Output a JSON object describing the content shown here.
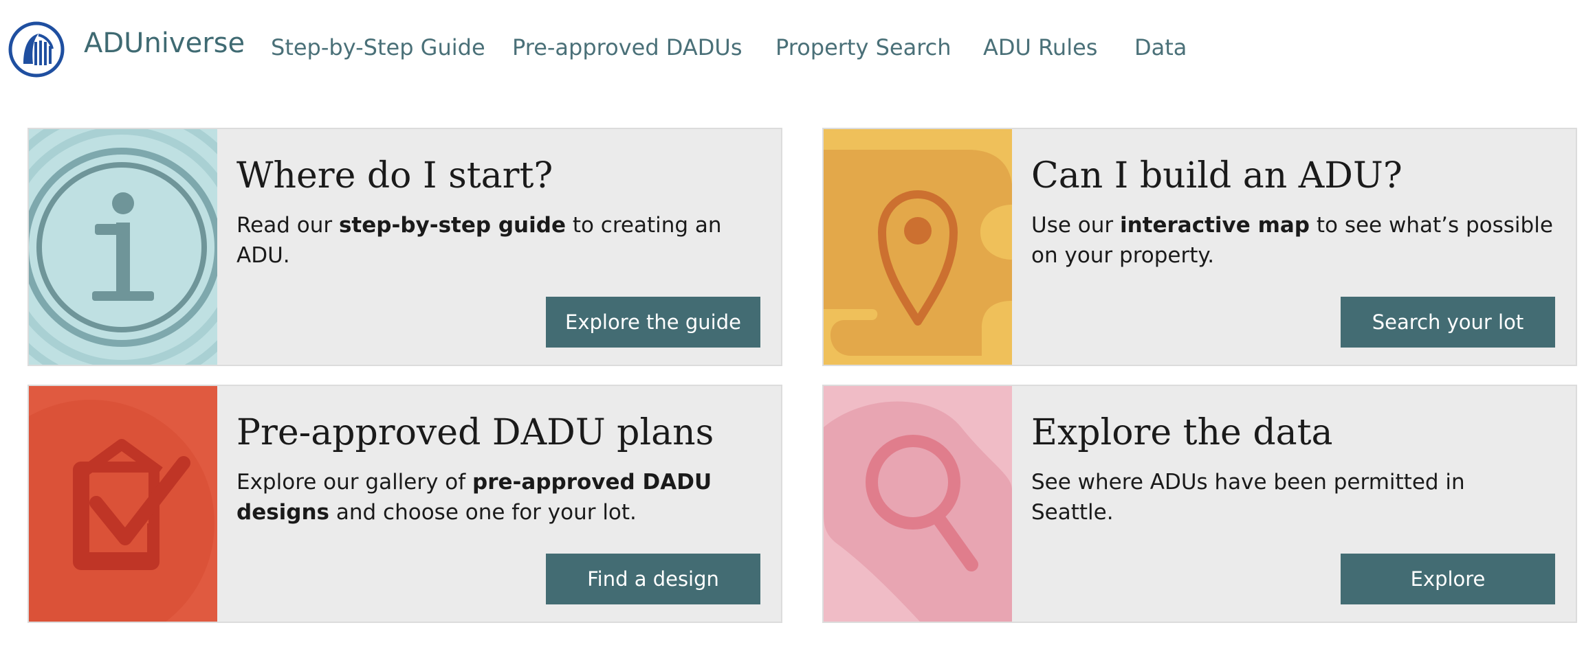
{
  "header": {
    "brand": "ADUniverse",
    "nav": [
      {
        "label": "Step-by-Step Guide"
      },
      {
        "label": "Pre-approved DADUs"
      },
      {
        "label": "Property Search"
      },
      {
        "label": "ADU Rules"
      },
      {
        "label": "Data"
      }
    ]
  },
  "cards": [
    {
      "title": "Where do I start?",
      "text_before": "Read our ",
      "text_bold": "step-by-step guide",
      "text_after": " to creating an ADU.",
      "button": "Explore the guide",
      "icon": "info-icon",
      "color": "#bfe0e2"
    },
    {
      "title": "Can I build an ADU?",
      "text_before": "Use our ",
      "text_bold": "interactive map",
      "text_after": " to see what’s possible on your property.",
      "button": "Search your lot",
      "icon": "map-pin-icon",
      "color": "#efc05a"
    },
    {
      "title": "Pre-approved DADU plans",
      "text_before": "Explore our gallery of ",
      "text_bold": "pre-approved DADU designs",
      "text_after": " and choose one for your lot.",
      "button": "Find a design",
      "icon": "house-check-icon",
      "color": "#e05a40"
    },
    {
      "title": "Explore the data",
      "text_before": "See where ADUs have been permitted in Seattle.",
      "text_bold": "",
      "text_after": "",
      "button": "Explore",
      "icon": "magnifier-icon",
      "color": "#f0bcc6"
    }
  ]
}
